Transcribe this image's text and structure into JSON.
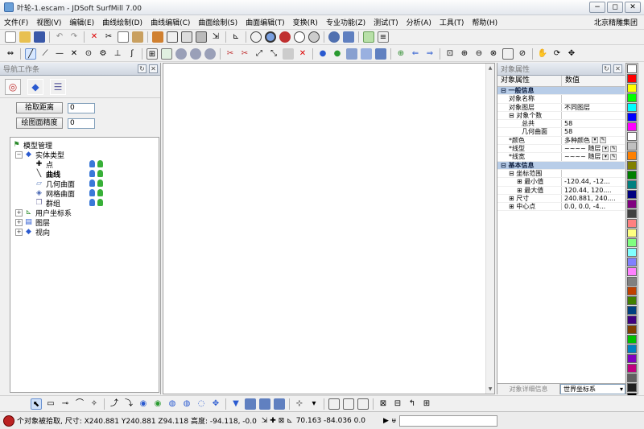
{
  "window": {
    "title": "叶轮-1.escam - JDSoft SurfMill 7.00",
    "buttons": {
      "minimize": "−",
      "restore": "◻",
      "close": "✕"
    }
  },
  "menu": {
    "items": [
      "文件(F)",
      "视图(V)",
      "编辑(E)",
      "曲线绘制(D)",
      "曲线编辑(C)",
      "曲面绘制(S)",
      "曲面编辑(T)",
      "变换(R)",
      "专业功能(Z)",
      "测试(T)",
      "分析(A)",
      "工具(T)",
      "帮助(H)"
    ],
    "brand": "北京精雕集团"
  },
  "left_panel": {
    "title": "导航工作条",
    "pick_distance_label": "拾取距离",
    "pick_distance_value": "0",
    "draw_precision_label": "绘图面精度",
    "draw_precision_value": "0",
    "tree": {
      "root": "模型管理",
      "entity_types": "实体类型",
      "point": "点",
      "curve": "曲线",
      "geom_surface": "几何曲面",
      "mesh_surface": "网格曲面",
      "group": "群组",
      "user_cs": "用户坐标系",
      "layer": "图层",
      "view": "视向"
    }
  },
  "right_panel": {
    "title": "对象属性",
    "col_prop": "对象属性",
    "col_value": "数值",
    "sections": {
      "general": "一般信息",
      "basic": "基本信息"
    },
    "rows": {
      "obj_name": "对象名称",
      "obj_layer": "对象图层",
      "obj_layer_value": "不同图层",
      "obj_count": "对象个数",
      "total": "总共",
      "total_value": "58",
      "geom_surface": "几何曲面",
      "geom_surface_value": "58",
      "color": "*颜色",
      "color_value": "多种颜色",
      "line_type": "*线型",
      "line_type_value": "随层",
      "line_width": "*线宽",
      "line_width_value": "随层",
      "bounds": "坐标范围",
      "min": "最小值",
      "min_value": "-120.44, -12...",
      "max": "最大值",
      "max_value": "120.44, 120....",
      "size": "尺寸",
      "size_value": "240.881, 240....",
      "center": "中心点",
      "center_value": "0.0, 0.0, -4..."
    },
    "bottom_button": "对象详细信息",
    "cs_select": "世界坐标系"
  },
  "palette": [
    "#ffffff",
    "#ff0000",
    "#ffff00",
    "#00ff00",
    "#00ffff",
    "#0000ff",
    "#ff00ff",
    "#ffffff",
    "#c0c0c0",
    "#ff8000",
    "#808000",
    "#008000",
    "#008080",
    "#000080",
    "#800080",
    "#404040",
    "#ff8080",
    "#ffff80",
    "#80ff80",
    "#80ffff",
    "#8080ff",
    "#ff80ff",
    "#808080",
    "#c04000",
    "#408000",
    "#004080",
    "#400080",
    "#804000",
    "#00c000",
    "#0080c0",
    "#8000c0",
    "#c00080",
    "#606060",
    "#202020",
    "#000000",
    "#e0e0e0"
  ],
  "status": {
    "message": "个对象被拾取, 尺寸: X240.881 Y240.881 Z94.118 高度: -94.118, -0.0",
    "coords": "70.163  -84.036  0.0"
  }
}
